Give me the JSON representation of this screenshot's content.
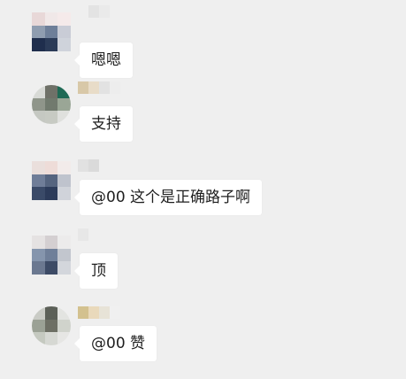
{
  "messages": [
    {
      "text": "嗯嗯",
      "avatar_round": false,
      "avatar_colors": [
        "#e8d8d8",
        "#f0e8e8",
        "#f5eaea",
        "#8f9db0",
        "#6e7f99",
        "#c9ccd6",
        "#1f2e4d",
        "#2b3b58",
        "#cfd3db"
      ],
      "name_colors": [
        "#efefef",
        "#e3e3e3",
        "#eaeaea"
      ]
    },
    {
      "text": "支持",
      "avatar_round": true,
      "avatar_colors": [
        "#d8dad6",
        "#6f7168",
        "#1f6a55",
        "#8f958a",
        "#717a6e",
        "#9aa696",
        "#c5c8c2",
        "#c7cac3",
        "#dfe0dd"
      ],
      "name_colors": [
        "#d8c8a8",
        "#e8dcc8",
        "#e2e2e2",
        "#ededed"
      ]
    },
    {
      "text": "@00 这个是正确路子啊",
      "avatar_round": false,
      "avatar_colors": [
        "#eadfdc",
        "#eedcd8",
        "#f2ebea",
        "#6f7d98",
        "#55647f",
        "#bfc3cd",
        "#3a4a68",
        "#2c3b5a",
        "#d0d3da"
      ],
      "name_colors": [
        "#e1e1e1",
        "#dadada"
      ]
    },
    {
      "text": "顶",
      "avatar_round": false,
      "avatar_colors": [
        "#e5e2e2",
        "#d4cfd1",
        "#ecebeb",
        "#8595ad",
        "#6f7f99",
        "#c2c6ce",
        "#6b7890",
        "#3d4b66",
        "#d3d6dc"
      ],
      "name_colors": [
        "#e7e7e7",
        "#efefef"
      ]
    },
    {
      "text": "@00 赞",
      "avatar_round": true,
      "avatar_colors": [
        "#c9cbc5",
        "#5c6058",
        "#e3e4e1",
        "#9ba195",
        "#6d6f64",
        "#d0d3cc",
        "#c5c9c0",
        "#d6d8d3",
        "#e6e6e4"
      ],
      "name_colors": [
        "#d3c18f",
        "#e9d9bb",
        "#e7e3d7",
        "#f0f0f0"
      ]
    }
  ]
}
